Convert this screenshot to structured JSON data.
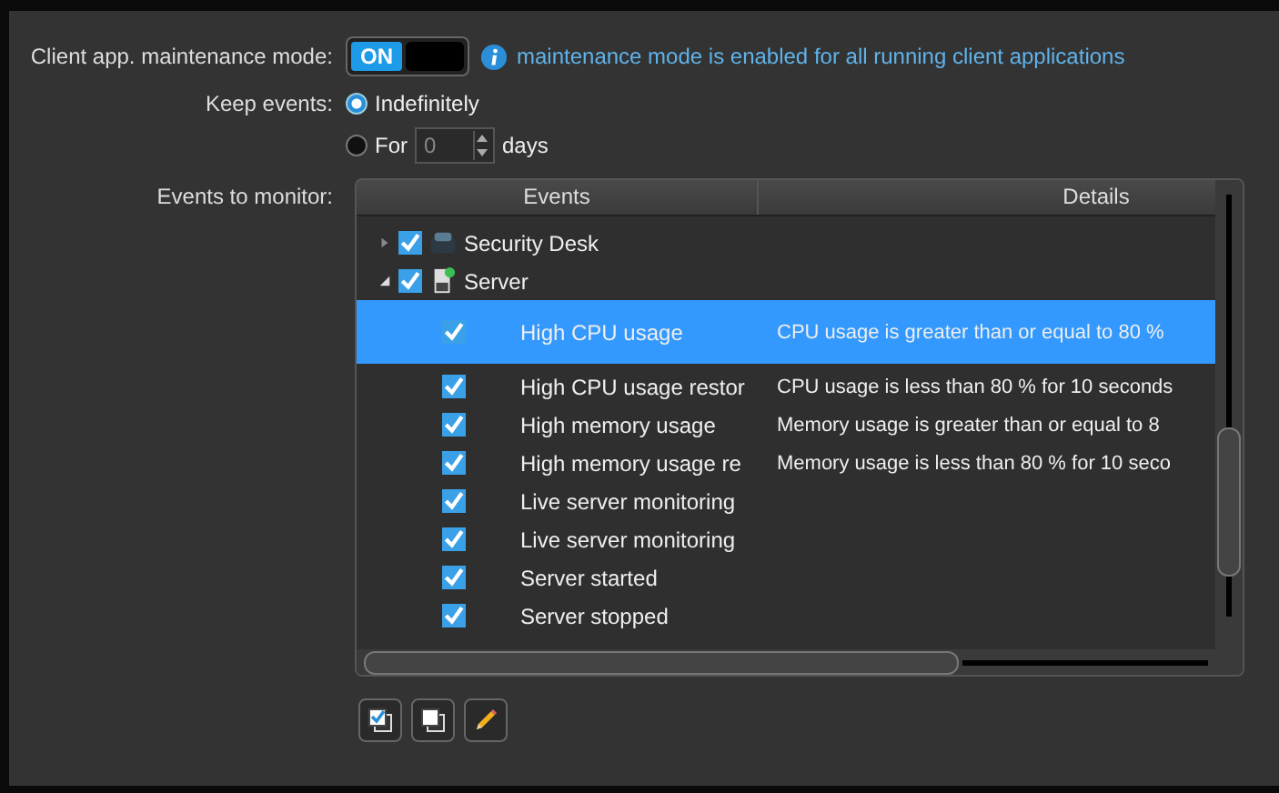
{
  "maintenance": {
    "label": "Client app. maintenance mode:",
    "toggle": {
      "text": "ON",
      "on": true
    },
    "info": "maintenance mode is enabled for all running client applications"
  },
  "keep_events": {
    "label": "Keep events:",
    "options": [
      {
        "kind": "plain",
        "label": "Indefinitely",
        "selected": true
      },
      {
        "kind": "days",
        "label": "For",
        "value": "0",
        "unit": "days",
        "selected": false
      }
    ]
  },
  "events": {
    "label": "Events to monitor:",
    "columns": [
      "Events",
      "Details"
    ],
    "groups": [
      {
        "name": "Security Desk",
        "expanded": false,
        "checked": true
      },
      {
        "name": "Server",
        "expanded": true,
        "checked": true,
        "children": [
          {
            "name": "High CPU usage",
            "details": "CPU usage is greater than or equal to 80 %",
            "checked": true,
            "selected": true
          },
          {
            "name": "High CPU usage restor",
            "details": "CPU usage is less than 80 % for 10 seconds",
            "checked": true,
            "selected": false
          },
          {
            "name": "High memory usage",
            "details": "Memory usage is greater than or equal to 8",
            "checked": true,
            "selected": false
          },
          {
            "name": "High memory usage re",
            "details": "Memory usage is less than 80 % for 10 seco",
            "checked": true,
            "selected": false
          },
          {
            "name": "Live server monitoring",
            "checked": true,
            "selected": false
          },
          {
            "name": "Live server monitoring",
            "checked": true,
            "selected": false
          },
          {
            "name": "Server started",
            "checked": true,
            "selected": false
          },
          {
            "name": "Server stopped",
            "checked": true,
            "selected": false
          }
        ]
      }
    ]
  }
}
